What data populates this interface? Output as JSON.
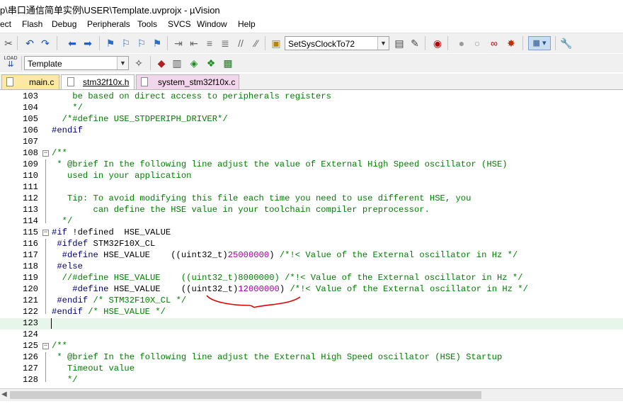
{
  "window": {
    "title": "p\\串口通信简单实例\\USER\\Template.uvprojx - µVision"
  },
  "menu": [
    {
      "label": "ect"
    },
    {
      "label": "Flash"
    },
    {
      "label": "Debug"
    },
    {
      "label": "Peripherals"
    },
    {
      "label": "Tools"
    },
    {
      "label": "SVCS"
    },
    {
      "label": "Window"
    },
    {
      "label": "Help"
    }
  ],
  "toolbar": {
    "function_combo": "SetSysClockTo72",
    "target_combo": "Template",
    "load_label": "LOAD"
  },
  "tabs": [
    {
      "label": "main.c"
    },
    {
      "label": "stm32f10x.h"
    },
    {
      "label": "system_stm32f10x.c"
    }
  ],
  "editor": {
    "active_file": "stm32f10x.h",
    "lines": [
      {
        "n": "103",
        "text": "    be based on direct access to peripherals registers"
      },
      {
        "n": "104",
        "text": "    */"
      },
      {
        "n": "105",
        "text": "  /*#define USE_STDPERIPH_DRIVER*/"
      },
      {
        "n": "106",
        "text": "#endif"
      },
      {
        "n": "107",
        "text": ""
      },
      {
        "n": "108",
        "text": "/**"
      },
      {
        "n": "109",
        "text": " * @brief In the following line adjust the value of External High Speed oscillator (HSE)"
      },
      {
        "n": "110",
        "text": "   used in your application"
      },
      {
        "n": "111",
        "text": ""
      },
      {
        "n": "112",
        "text": "   Tip: To avoid modifying this file each time you need to use different HSE, you"
      },
      {
        "n": "113",
        "text": "        can define the HSE value in your toolchain compiler preprocessor."
      },
      {
        "n": "114",
        "text": "  */"
      },
      {
        "n": "115",
        "text": "#if !defined  HSE_VALUE"
      },
      {
        "n": "116",
        "text": " #ifdef STM32F10X_CL"
      },
      {
        "n": "117",
        "text": "  #define HSE_VALUE    ((uint32_t)25000000) /*!< Value of the External oscillator in Hz */"
      },
      {
        "n": "118",
        "text": " #else"
      },
      {
        "n": "119",
        "text": "  //#define HSE_VALUE    ((uint32_t)8000000) /*!< Value of the External oscillator in Hz */"
      },
      {
        "n": "120",
        "text": "    #define HSE_VALUE    ((uint32_t)12000000) /*!< Value of the External oscillator in Hz */"
      },
      {
        "n": "121",
        "text": " #endif /* STM32F10X_CL */"
      },
      {
        "n": "122",
        "text": "#endif /* HSE_VALUE */"
      },
      {
        "n": "123",
        "text": ""
      },
      {
        "n": "124",
        "text": ""
      },
      {
        "n": "125",
        "text": "/**"
      },
      {
        "n": "126",
        "text": " * @brief In the following line adjust the External High Speed oscillator (HSE) Startup"
      },
      {
        "n": "127",
        "text": "   Timeout value"
      },
      {
        "n": "128",
        "text": "   */"
      }
    ]
  },
  "colors": {
    "comment": "#008000",
    "preprocessor": "#000080",
    "number": "#a000a0",
    "current_line": "#e6f6ea",
    "annotation": "#e00000"
  }
}
